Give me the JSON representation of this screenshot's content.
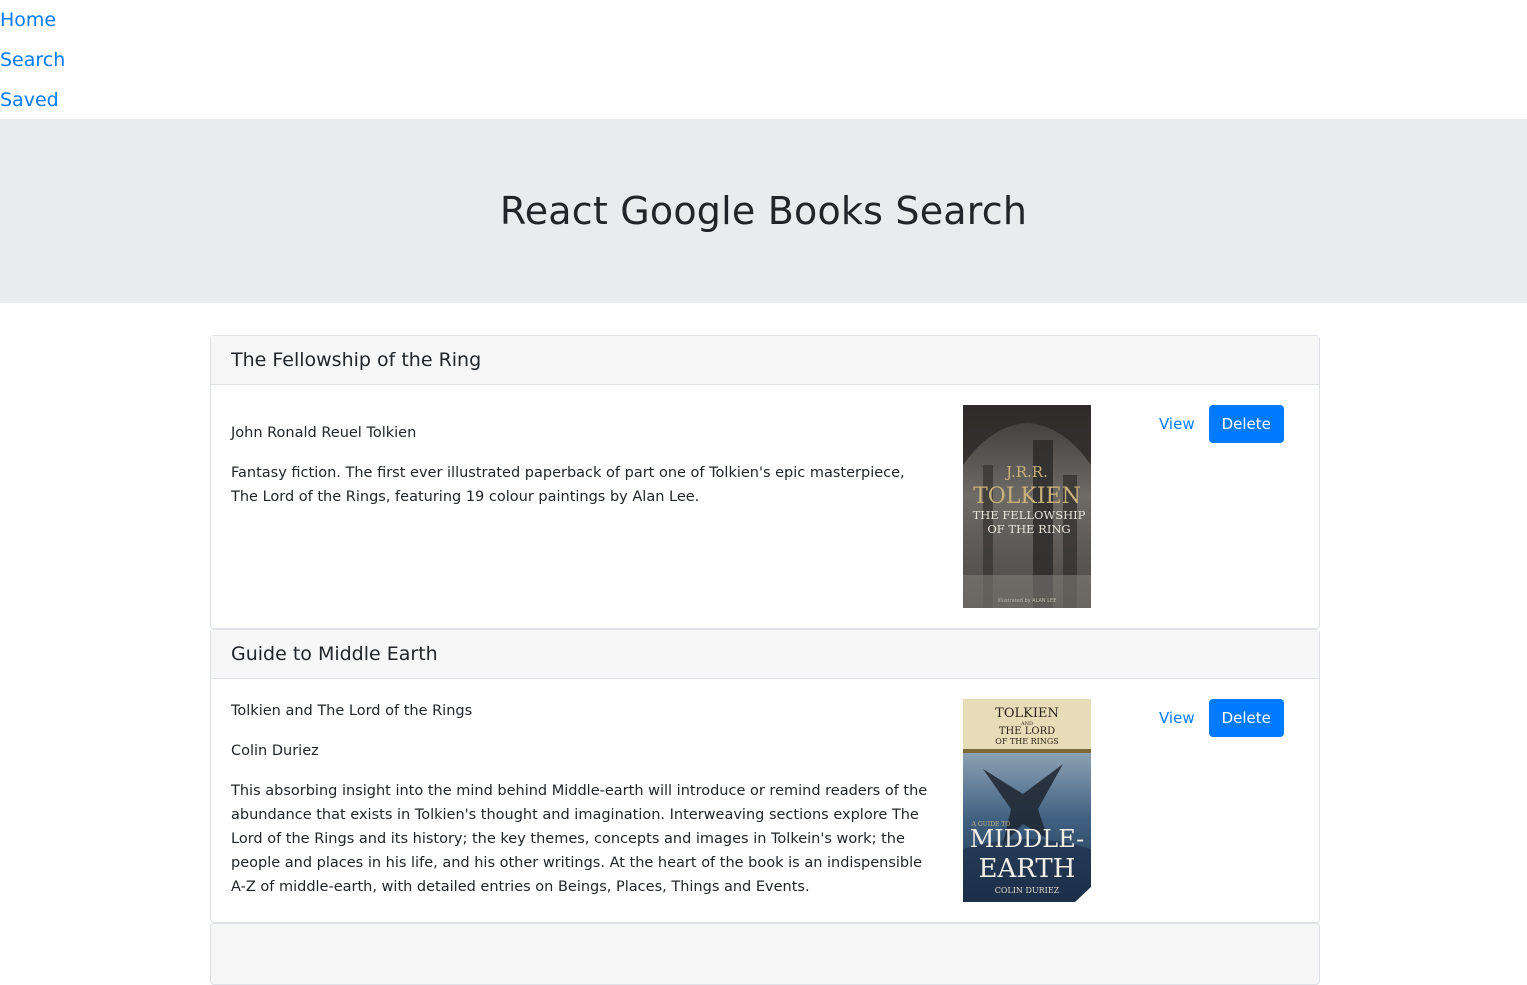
{
  "nav": {
    "items": [
      "Home",
      "Search",
      "Saved"
    ]
  },
  "header": {
    "title": "React Google Books Search"
  },
  "books": [
    {
      "title": "The Fellowship of the Ring",
      "subtitle": "",
      "author": "John Ronald Reuel Tolkien",
      "description": "Fantasy fiction. The first ever illustrated paperback of part one of Tolkien's epic masterpiece, The Lord of the Rings, featuring 19 colour paintings by Alan Lee.",
      "cover": {
        "line1": "J.R.R.",
        "line2": "TOLKIEN",
        "line3": "THE FELLOWSHIP",
        "line4": "OF THE RING",
        "footer": "illustrated by ALAN LEE"
      },
      "view_label": "View",
      "delete_label": "Delete"
    },
    {
      "title": "Guide to Middle Earth",
      "subtitle": "Tolkien and The Lord of the Rings",
      "author": "Colin Duriez",
      "description": "This absorbing insight into the mind behind Middle-earth will introduce or remind readers of the abundance that exists in Tolkien's thought and imagination. Interweaving sections explore The Lord of the Rings and its history; the key themes, concepts and images in Tolkein's work; the people and places in his life, and his other writings. At the heart of the book is an indispensible A-Z of middle-earth, with detailed entries on Beings, Places, Things and Events.",
      "cover": {
        "line1": "TOLKIEN",
        "line2": "AND",
        "line3": "THE LORD",
        "line4": "OF THE RINGS",
        "line5": "A GUIDE TO",
        "line6": "MIDDLE-",
        "line7": "EARTH",
        "footer": "COLIN DURIEZ"
      },
      "view_label": "View",
      "delete_label": "Delete"
    }
  ],
  "colors": {
    "link": "#007bff",
    "jumbotron_bg": "#e9ecef",
    "card_header_bg": "#f7f7f7",
    "button_primary": "#007bff"
  }
}
